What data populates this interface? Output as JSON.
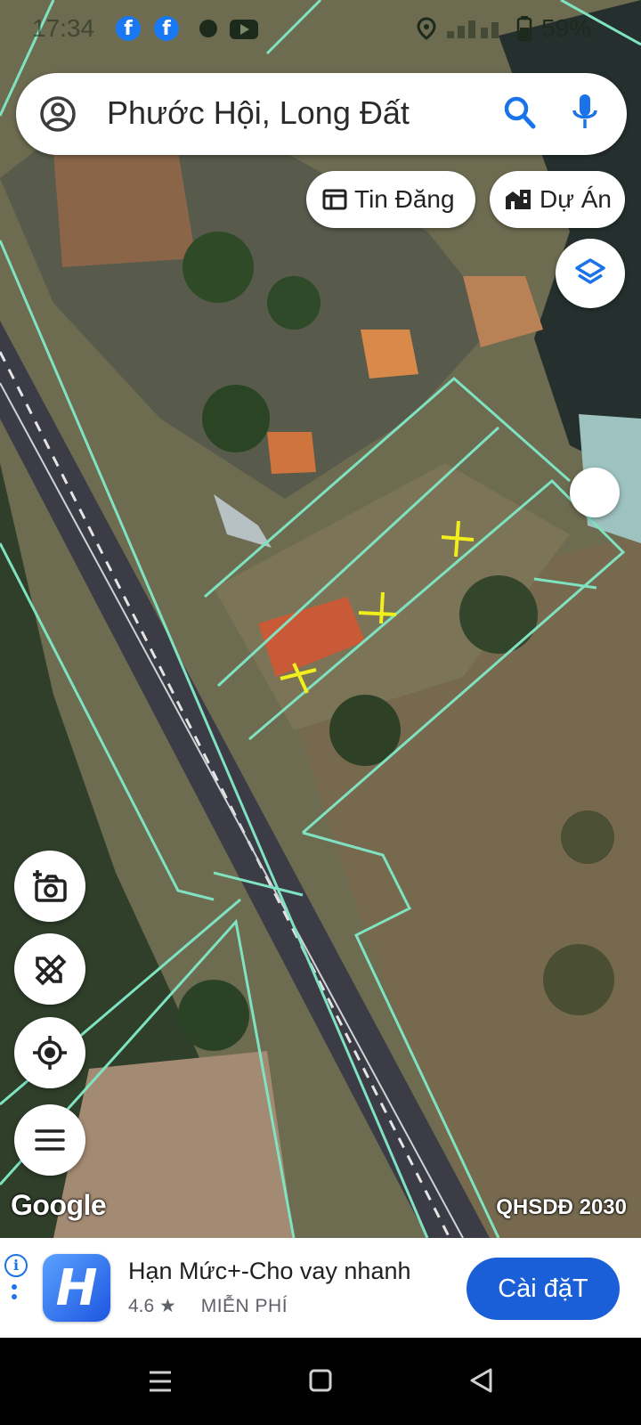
{
  "status_bar": {
    "time": "17:34",
    "battery": "59%"
  },
  "search": {
    "query": "Phước Hội, Long Đất"
  },
  "chips": {
    "listings": "Tin Đăng",
    "projects": "Dự Án"
  },
  "map": {
    "attribution": "Google",
    "layer_label": "QHSDĐ 2030"
  },
  "ad": {
    "app_name": "Hạn Mức+-Cho vay nhanh",
    "rating": "4.6",
    "price": "MIỄN PHÍ",
    "install_label": "Cài đặT",
    "icon_letter": "H"
  },
  "colors": {
    "parcel_line": "#7fe3c2",
    "marker": "#f2ee1c",
    "accent": "#1a5ed8"
  }
}
